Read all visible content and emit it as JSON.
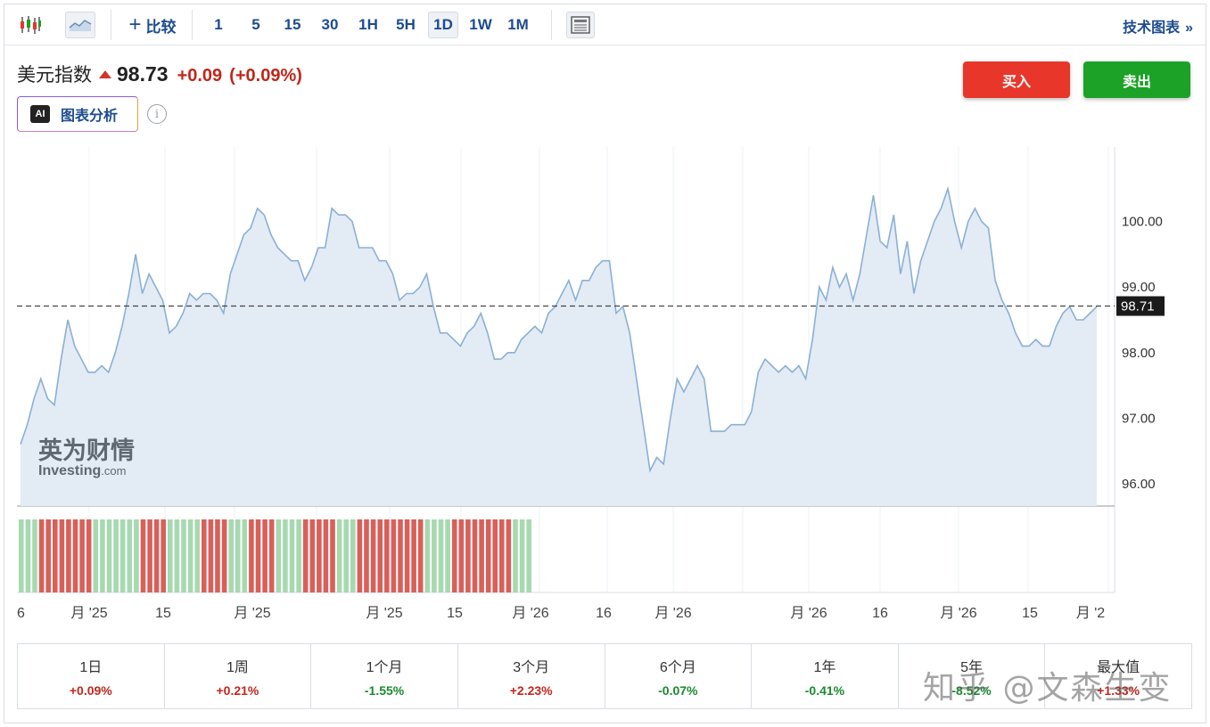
{
  "toolbar": {
    "compare_label": "比较",
    "intervals": [
      "1",
      "5",
      "15",
      "30",
      "1H",
      "5H",
      "1D",
      "1W",
      "1M"
    ],
    "active_interval": "1D",
    "tech_chart_label": "技术图表"
  },
  "instrument": {
    "name": "美元指数",
    "price": "98.73",
    "change": "+0.09",
    "change_pct": "(+0.09%)"
  },
  "ai_button_label": "图表分析",
  "ai_badge": "AI",
  "buy_label": "买入",
  "sell_label": "卖出",
  "logo": {
    "cn": "英为财情",
    "en": "Investing",
    "suffix": ".com"
  },
  "chart_data": {
    "type": "area",
    "current_value_label": "98.71",
    "y_ticks": [
      "100.00",
      "99.00",
      "98.00",
      "97.00",
      "96.00"
    ],
    "ylim": [
      95.7,
      101.0
    ],
    "x_tick_labels": [
      "6",
      "月 '25",
      "15",
      "月 '25",
      "月 '25",
      "15",
      "月 '26",
      "16",
      "月 '26",
      "月 '26",
      "16",
      "月 '26",
      "15",
      "月 '2"
    ],
    "values": [
      96.6,
      96.9,
      97.3,
      97.6,
      97.3,
      97.2,
      97.9,
      98.5,
      98.1,
      97.9,
      97.7,
      97.7,
      97.8,
      97.7,
      98.0,
      98.4,
      98.9,
      99.5,
      98.9,
      99.2,
      99.0,
      98.8,
      98.3,
      98.4,
      98.6,
      98.9,
      98.8,
      98.9,
      98.9,
      98.8,
      98.6,
      99.2,
      99.5,
      99.8,
      99.9,
      100.2,
      100.1,
      99.8,
      99.6,
      99.5,
      99.4,
      99.4,
      99.1,
      99.3,
      99.6,
      99.6,
      100.2,
      100.1,
      100.1,
      100.0,
      99.6,
      99.6,
      99.6,
      99.4,
      99.4,
      99.2,
      98.8,
      98.9,
      98.9,
      99.0,
      99.2,
      98.7,
      98.3,
      98.3,
      98.2,
      98.1,
      98.3,
      98.4,
      98.6,
      98.3,
      97.9,
      97.9,
      98.0,
      98.0,
      98.2,
      98.3,
      98.4,
      98.3,
      98.6,
      98.7,
      98.9,
      99.1,
      98.8,
      99.1,
      99.1,
      99.3,
      99.4,
      99.4,
      98.6,
      98.7,
      98.3,
      97.6,
      96.9,
      96.2,
      96.4,
      96.3,
      97.0,
      97.6,
      97.4,
      97.6,
      97.8,
      97.6,
      96.8,
      96.8,
      96.8,
      96.9,
      96.9,
      96.9,
      97.1,
      97.7,
      97.9,
      97.8,
      97.7,
      97.8,
      97.7,
      97.8,
      97.6,
      98.2,
      99.0,
      98.8,
      99.3,
      99.0,
      99.2,
      98.8,
      99.2,
      99.8,
      100.4,
      99.7,
      99.6,
      100.1,
      99.2,
      99.7,
      98.9,
      99.4,
      99.7,
      100.0,
      100.2,
      100.5,
      100.0,
      99.6,
      100.0,
      100.2,
      100.0,
      99.9,
      99.1,
      98.8,
      98.6,
      98.3,
      98.1,
      98.1,
      98.2,
      98.1,
      98.1,
      98.4,
      98.6,
      98.7,
      98.5,
      98.5,
      98.6,
      98.7
    ],
    "volume_colors": "gggrrrrrrrrgggggggrrrrgggggrrrrgggrrrrggggrrrrrgggrrrrrrrrrrggggrrrrrrrrrggg"
  },
  "stats": [
    {
      "label": "1日",
      "value": "+0.09%",
      "dir": "pos"
    },
    {
      "label": "1周",
      "value": "+0.21%",
      "dir": "pos"
    },
    {
      "label": "1个月",
      "value": "-1.55%",
      "dir": "neg"
    },
    {
      "label": "3个月",
      "value": "+2.23%",
      "dir": "pos"
    },
    {
      "label": "6个月",
      "value": "-0.07%",
      "dir": "neg"
    },
    {
      "label": "1年",
      "value": "-0.41%",
      "dir": "neg"
    },
    {
      "label": "5年",
      "value": "-8.52%",
      "dir": "neg"
    },
    {
      "label": "最大值",
      "value": "+1.33%",
      "dir": "pos"
    }
  ],
  "watermark": "知乎 @文森生变"
}
